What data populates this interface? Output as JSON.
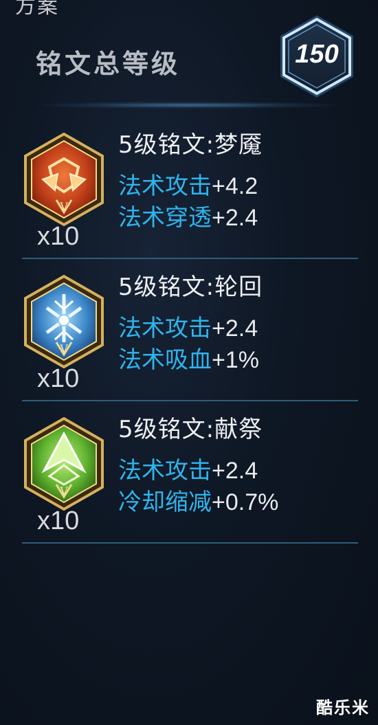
{
  "header": {
    "top_label": "方案",
    "total_title": "铭文总等级",
    "total_level": "150"
  },
  "runes": [
    {
      "count": "x10",
      "name": "5级铭文:梦魇",
      "stats": [
        {
          "label": "法术攻击",
          "value": "+4.2"
        },
        {
          "label": "法术穿透",
          "value": "+2.4"
        }
      ],
      "color": "#c2411a",
      "icon": "red-rune-icon"
    },
    {
      "count": "x10",
      "name": "5级铭文:轮回",
      "stats": [
        {
          "label": "法术攻击",
          "value": "+2.4"
        },
        {
          "label": "法术吸血",
          "value": "+1%"
        }
      ],
      "color": "#3c86c8",
      "icon": "blue-rune-icon"
    },
    {
      "count": "x10",
      "name": "5级铭文:献祭",
      "stats": [
        {
          "label": "法术攻击",
          "value": "+2.4"
        },
        {
          "label": "冷却缩减",
          "value": "+0.7%"
        }
      ],
      "color": "#5fb22f",
      "icon": "green-rune-icon"
    }
  ],
  "watermark": "酷乐米",
  "colors": {
    "stat_label": "#2fb4ec",
    "divider": "#2f5d78",
    "gold_frame": "#d6b15c",
    "badge_glow": "#7fc4ff"
  }
}
